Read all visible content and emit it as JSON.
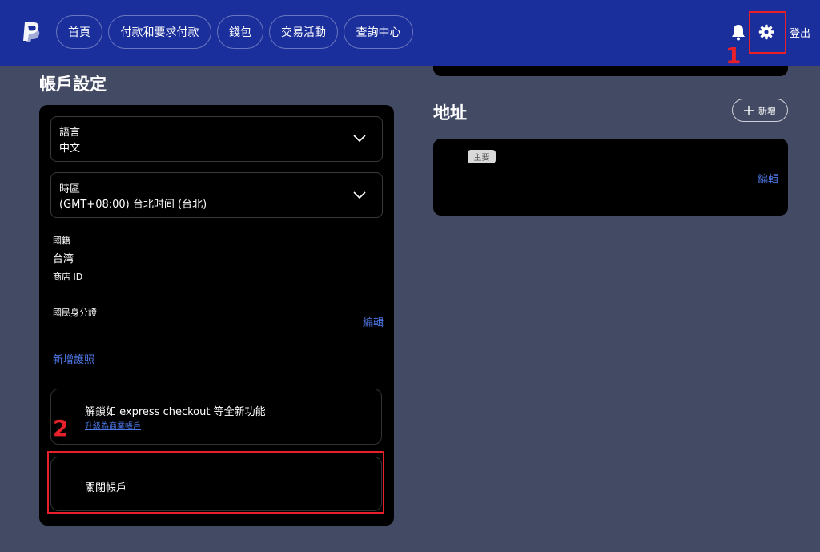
{
  "header": {
    "nav": [
      {
        "label": "首頁"
      },
      {
        "label": "付款和要求付款"
      },
      {
        "label": "錢包"
      },
      {
        "label": "交易活動"
      },
      {
        "label": "查詢中心"
      }
    ],
    "logout_label": "登出"
  },
  "annotations": {
    "step1": "1",
    "step2": "2"
  },
  "account_settings": {
    "title": "帳戶設定",
    "language": {
      "label": "語言",
      "value": "中文"
    },
    "timezone": {
      "label": "時區",
      "value": "(GMT+08:00) 台北时间 (台北)"
    },
    "nationality": {
      "label": "國籍",
      "value": "台湾"
    },
    "store_id": {
      "label": "商店 ID"
    },
    "national_id": {
      "label": "國民身分證",
      "edit_label": "編輯"
    },
    "add_passport_label": "新增護照",
    "upgrade": {
      "text": "解鎖如 express checkout 等全新功能",
      "link": "升級為商業帳戶"
    },
    "close_account_label": "關閉帳戶"
  },
  "address": {
    "title": "地址",
    "add_label": "新增",
    "primary_badge": "主要",
    "edit_label": "編輯"
  },
  "colors": {
    "header_bg": "#1a2e9c",
    "page_bg": "#434a63",
    "card_bg": "#000000",
    "link": "#4e77e6",
    "annotation_red": "#e8202a"
  }
}
